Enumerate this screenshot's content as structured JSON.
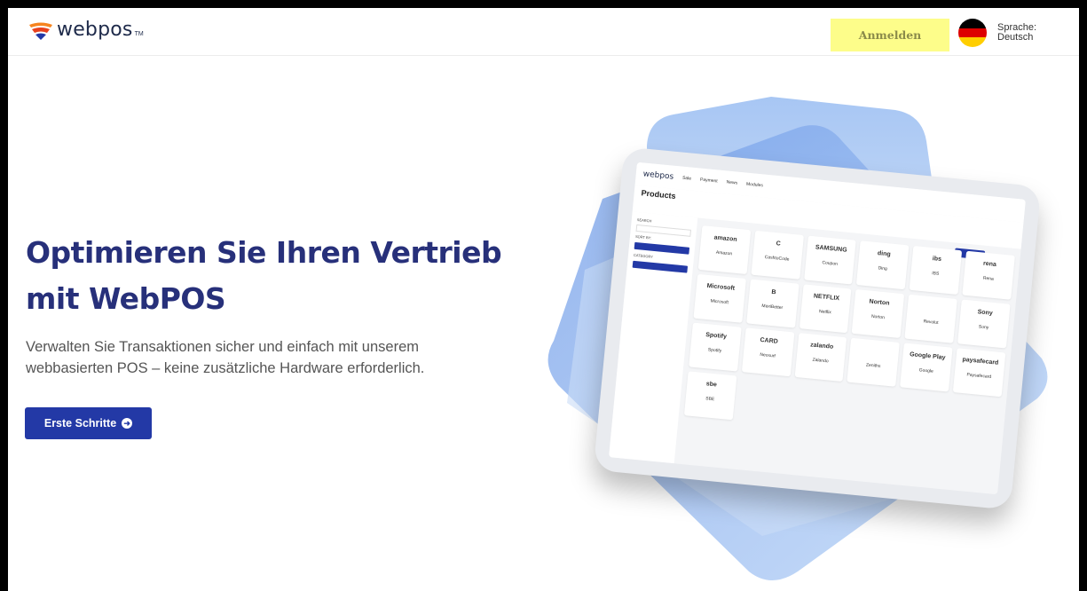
{
  "header": {
    "logo_text": "webpos",
    "logo_tm": "TM",
    "login_label": "Anmelden",
    "language_label": "Sprache:",
    "language_value": "Deutsch"
  },
  "hero": {
    "title_line1": "Optimieren Sie Ihren Vertrieb",
    "title_line2": "mit WebPOS",
    "subtitle_line1": "Verwalten Sie Transaktionen sicher und einfach mit unserem",
    "subtitle_line2": "webbasierten POS – keine zusätzliche Hardware erforderlich.",
    "cta_label": "Erste Schritte"
  },
  "mockup": {
    "nav": [
      "Sale",
      "Payment",
      "News",
      "Modules"
    ],
    "page_title": "Products",
    "search_label": "SEARCH",
    "sort_label": "SORT BY:",
    "category_label": "CATEGORY",
    "tiles": [
      {
        "brand": "amazon",
        "name": "Amazon"
      },
      {
        "brand": "C",
        "name": "CashtoCode"
      },
      {
        "brand": "SAMSUNG",
        "name": "Coupon"
      },
      {
        "brand": "ding",
        "name": "Ding"
      },
      {
        "brand": "ibs",
        "name": "IBS"
      },
      {
        "brand": "rena",
        "name": "Rena"
      },
      {
        "brand": "Microsoft",
        "name": "Microsoft"
      },
      {
        "brand": "B",
        "name": "MaxiBetter"
      },
      {
        "brand": "NETFLIX",
        "name": "Netflix"
      },
      {
        "brand": "Norton",
        "name": "Norton"
      },
      {
        "brand": "",
        "name": "Revolut"
      },
      {
        "brand": "Sony",
        "name": "Sony"
      },
      {
        "brand": "Spotify",
        "name": "Spotify"
      },
      {
        "brand": "CARD",
        "name": "Neosurf"
      },
      {
        "brand": "zalando",
        "name": "Zalando"
      },
      {
        "brand": "",
        "name": "Zeniths"
      },
      {
        "brand": "Google Play",
        "name": "Google"
      },
      {
        "brand": "paysafecard",
        "name": "Paysafecard"
      },
      {
        "brand": "sbe",
        "name": "SBE"
      }
    ]
  },
  "colors": {
    "accent": "#2339a6",
    "title": "#27307a",
    "highlight": "#fdfd8a"
  }
}
